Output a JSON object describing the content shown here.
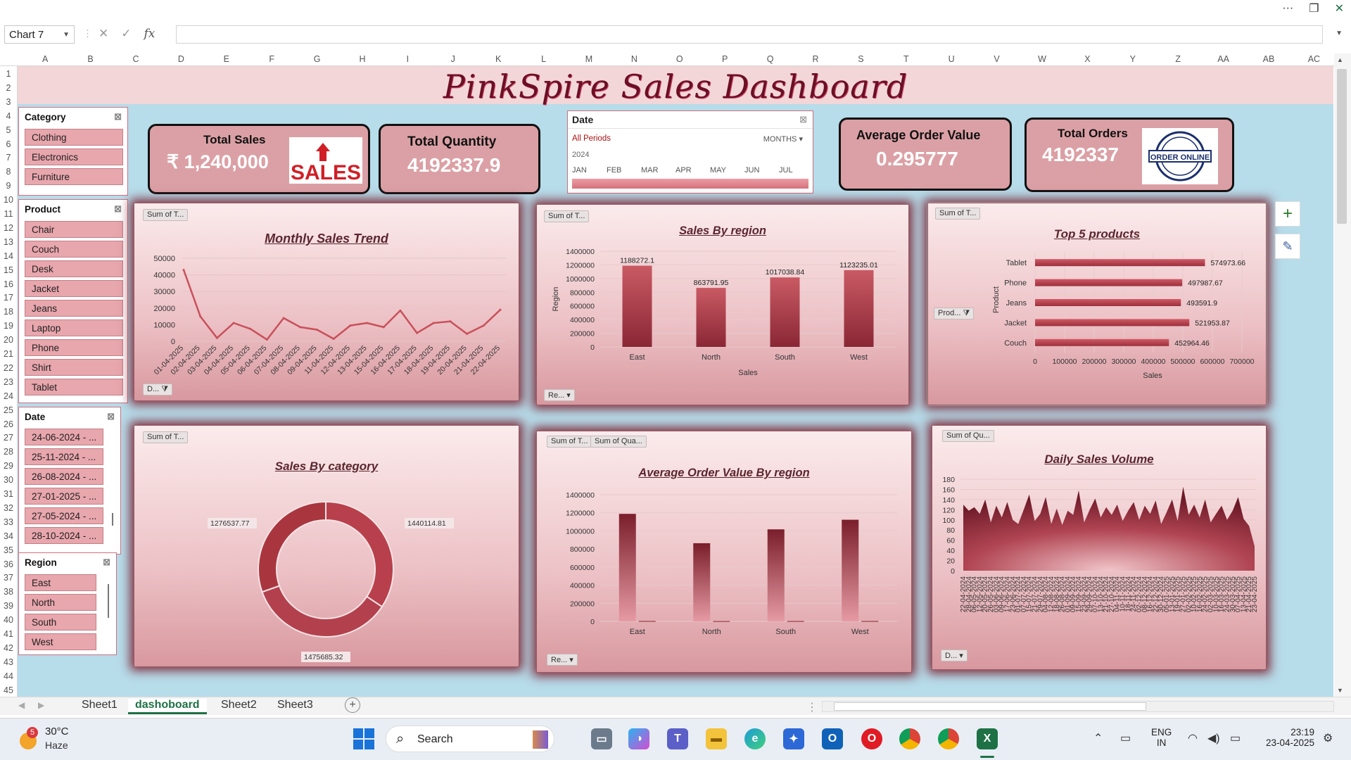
{
  "window": {
    "more_label": "···"
  },
  "formula_bar": {
    "name_box": "Chart 7",
    "fx": "fx",
    "value": ""
  },
  "columns": [
    "A",
    "B",
    "C",
    "D",
    "E",
    "F",
    "G",
    "H",
    "I",
    "J",
    "K",
    "L",
    "M",
    "N",
    "O",
    "P",
    "Q",
    "R",
    "S",
    "T",
    "U",
    "V",
    "W",
    "X",
    "Y",
    "Z",
    "AA",
    "AB",
    "AC"
  ],
  "rows": [
    "1",
    "2",
    "3",
    "4",
    "5",
    "6",
    "7",
    "8",
    "9",
    "10",
    "11",
    "12",
    "13",
    "14",
    "15",
    "16",
    "17",
    "18",
    "19",
    "20",
    "21",
    "22",
    "23",
    "24",
    "25",
    "26",
    "27",
    "28",
    "29",
    "30",
    "31",
    "32",
    "33",
    "34",
    "35",
    "36",
    "37",
    "38",
    "39",
    "40",
    "41",
    "42",
    "43",
    "44",
    "45"
  ],
  "dashboard": {
    "title": "PinkSpire Sales Dashboard"
  },
  "slicers": {
    "category": {
      "title": "Category",
      "items": [
        "Clothing",
        "Electronics",
        "Furniture"
      ]
    },
    "product": {
      "title": "Product",
      "items": [
        "Chair",
        "Couch",
        "Desk",
        "Jacket",
        "Jeans",
        "Laptop",
        "Phone",
        "Shirt",
        "Tablet"
      ]
    },
    "date": {
      "title": "Date",
      "items": [
        "24-06-2024 - ...",
        "25-11-2024 - ...",
        "26-08-2024 - ...",
        "27-01-2025 - ...",
        "27-05-2024 - ...",
        "28-10-2024 - ..."
      ]
    },
    "region": {
      "title": "Region",
      "items": [
        "East",
        "North",
        "South",
        "West"
      ]
    }
  },
  "kpis": {
    "total_sales": {
      "label": "Total Sales",
      "value": "₹ 1,240,000",
      "image_text": "SALES"
    },
    "total_quantity": {
      "label": "Total Quantity",
      "value": "4192337.9"
    },
    "avg_order_value": {
      "label": "Average Order Value",
      "value": "0.295777"
    },
    "total_orders": {
      "label": "Total Orders",
      "value": "4192337",
      "badge_text": "ORDER ONLINE"
    }
  },
  "timeline": {
    "title": "Date",
    "period": "All Periods",
    "level": "MONTHS",
    "year": "2024",
    "months": [
      "JAN",
      "FEB",
      "MAR",
      "APR",
      "MAY",
      "JUN",
      "JUL"
    ]
  },
  "pills": {
    "sum_t": "Sum of T...",
    "sum_qua": "Sum of Qua...",
    "sum_qu": "Sum of Qu...",
    "d_filter": "D...",
    "re_filter": "Re...",
    "prod_filter": "Prod..."
  },
  "chart_data": [
    {
      "id": "monthly",
      "type": "line",
      "title": "Monthly Sales Trend",
      "categories": [
        "01-04-2025",
        "02-04-2025",
        "03-04-2025",
        "04-04-2025",
        "05-04-2025",
        "06-04-2025",
        "07-04-2025",
        "08-04-2025",
        "09-04-2025",
        "11-04-2025",
        "12-04-2025",
        "13-04-2025",
        "15-04-2025",
        "16-04-2025",
        "17-04-2025",
        "18-04-2025",
        "19-04-2025",
        "20-04-2025",
        "21-04-2025",
        "22-04-2025"
      ],
      "values": [
        43000,
        15000,
        2000,
        11000,
        7500,
        1000,
        14000,
        8500,
        7000,
        1500,
        9500,
        11000,
        8500,
        18500,
        5000,
        11000,
        12000,
        4500,
        9500,
        19000
      ],
      "yticks": [
        "0",
        "10000",
        "20000",
        "30000",
        "40000",
        "50000"
      ],
      "ylim": [
        0,
        50000
      ]
    },
    {
      "id": "region",
      "type": "bar",
      "title": "Sales By region",
      "categories": [
        "East",
        "North",
        "South",
        "West"
      ],
      "values": [
        1188272.1,
        863791.95,
        1017038.84,
        1123235.01
      ],
      "labels": [
        "1188272.1",
        "863791.95",
        "1017038.84",
        "1123235.01"
      ],
      "yticks": [
        "0",
        "200000",
        "400000",
        "600000",
        "800000",
        "1000000",
        "1200000",
        "1400000"
      ],
      "ylim": [
        0,
        1400000
      ],
      "xlabel": "Sales",
      "ylabel": "Region"
    },
    {
      "id": "top5",
      "type": "bar",
      "title": "Top 5 products",
      "categories": [
        "Tablet",
        "Phone",
        "Jeans",
        "Jacket",
        "Couch"
      ],
      "values": [
        574973.66,
        497987.67,
        493591.9,
        521953.87,
        452964.46
      ],
      "labels": [
        "574973.66",
        "497987.67",
        "493591.9",
        "521953.87",
        "452964.46"
      ],
      "xticks": [
        "0",
        "100000",
        "200000",
        "300000",
        "400000",
        "500000",
        "600000",
        "700000"
      ],
      "xlim": [
        0,
        700000
      ],
      "xlabel": "Sales",
      "ylabel": "Product"
    },
    {
      "id": "category",
      "type": "pie",
      "title": "Sales By category",
      "values": [
        1440114.81,
        1475685.32,
        1276537.77
      ],
      "labels": [
        "1440114.81",
        "1475685.32",
        "1276537.77"
      ]
    },
    {
      "id": "aov",
      "type": "bar",
      "title": "Average Order Value By region",
      "categories": [
        "East",
        "North",
        "South",
        "West"
      ],
      "series": [
        {
          "values": [
            1188272.1,
            863791.95,
            1017038.84,
            1123235.01
          ]
        },
        {
          "values": [
            4000,
            3000,
            3500,
            3800
          ]
        }
      ],
      "yticks": [
        "0",
        "200000",
        "400000",
        "600000",
        "800000",
        "1000000",
        "1200000",
        "1400000"
      ],
      "ylim": [
        0,
        1400000
      ]
    },
    {
      "id": "daily",
      "type": "area",
      "title": "Daily Sales Volume",
      "categories": [
        "22-04-2024",
        "28-04-2024",
        "06-05-2024",
        "12-05-2024",
        "20-05-2024",
        "26-05-2024",
        "03-06-2024",
        "09-06-2024",
        "17-06-2024",
        "23-06-2024",
        "01-07-2024",
        "07-07-2024",
        "15-07-2024",
        "21-07-2024",
        "29-07-2024",
        "04-08-2024",
        "12-08-2024",
        "18-08-2024",
        "26-08-2024",
        "01-09-2024",
        "09-09-2024",
        "15-09-2024",
        "23-09-2024",
        "29-09-2024",
        "07-10-2024",
        "13-10-2024",
        "21-10-2024",
        "27-10-2024",
        "04-11-2024",
        "10-11-2024",
        "18-11-2024",
        "24-11-2024",
        "02-12-2024",
        "08-12-2024",
        "16-12-2024",
        "22-12-2024",
        "30-12-2024",
        "05-01-2025",
        "13-01-2025",
        "19-01-2025",
        "27-01-2025",
        "02-02-2025",
        "10-02-2025",
        "16-02-2025",
        "24-02-2025",
        "02-03-2025",
        "10-03-2025",
        "16-03-2025",
        "24-03-2025",
        "30-03-2025",
        "07-04-2025",
        "13-04-2025",
        "21-04-2025",
        "23-04-2025"
      ],
      "values": [
        130,
        118,
        125,
        112,
        140,
        95,
        128,
        105,
        135,
        100,
        92,
        120,
        150,
        98,
        112,
        145,
        92,
        122,
        90,
        118,
        110,
        158,
        95,
        120,
        142,
        105,
        125,
        110,
        130,
        98,
        118,
        135,
        100,
        128,
        112,
        138,
        92,
        115,
        140,
        98,
        165,
        110,
        130,
        105,
        140,
        95,
        112,
        128,
        100,
        118,
        145,
        102,
        88,
        48
      ],
      "yticks": [
        "0",
        "20",
        "40",
        "60",
        "80",
        "100",
        "120",
        "140",
        "160",
        "180"
      ],
      "ylim": [
        0,
        180
      ]
    }
  ],
  "sheet_tabs": [
    "Sheet1",
    "dashoboard",
    "Sheet2",
    "Sheet3"
  ],
  "active_sheet": "dashoboard",
  "taskbar": {
    "weather_temp": "30°C",
    "weather_desc": "Haze",
    "weather_badge": "5",
    "search": "Search",
    "lang1": "ENG",
    "lang2": "IN",
    "time": "23:19",
    "date": "23-04-2025"
  },
  "colors": {
    "bar": "#c14c57",
    "bar_dark": "#7a1e2b",
    "line": "#c9505b",
    "panel_glow": "#7e2d3c",
    "sheet_bg": "#b7dcea"
  }
}
